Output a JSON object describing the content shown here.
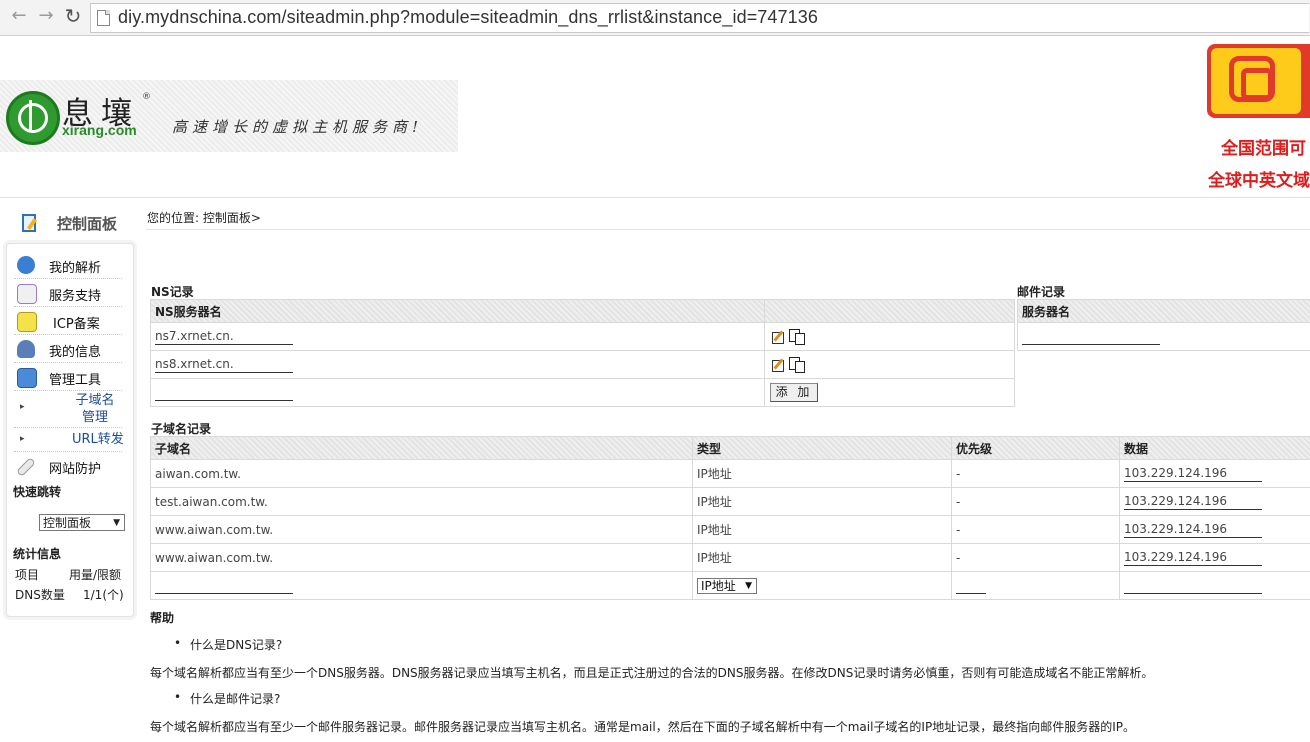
{
  "browser": {
    "url": "diy.mydnschina.com/siteadmin.php?module=siteadmin_dns_rrlist&instance_id=747136"
  },
  "header": {
    "logo_cn": "息壤",
    "logo_reg": "®",
    "logo_en": "xirang.com",
    "slogan": "高速增长的虚拟主机服务商!",
    "ad_line1": "全国范围可",
    "ad_line2": "全球中英文域"
  },
  "sidebar": {
    "title": "控制面板",
    "menu": [
      {
        "label": "我的解析",
        "icon": "globe-icon"
      },
      {
        "label": "服务支持",
        "icon": "person-icon"
      },
      {
        "label": "ICP备案",
        "icon": "certificate-icon"
      },
      {
        "label": "我的信息",
        "icon": "user-icon"
      },
      {
        "label": "管理工具",
        "icon": "tools-icon"
      }
    ],
    "submenu": [
      {
        "label": "子域名管理"
      },
      {
        "label": "URL转发"
      }
    ],
    "protect": {
      "label": "网站防护",
      "icon": "shield-icon"
    },
    "quick_title": "快速跳转",
    "quick_select": "控制面板",
    "stats_title": "统计信息",
    "stats_header": {
      "item": "项目",
      "usage": "用量/限额"
    },
    "stats_row": {
      "item": "DNS数量",
      "usage": "1/1(个)"
    }
  },
  "breadcrumb": "您的位置: 控制面板>",
  "ns": {
    "title": "NS记录",
    "header": "NS服务器名",
    "rows": [
      "ns7.xrnet.cn.",
      "ns8.xrnet.cn."
    ],
    "add_label": "添 加"
  },
  "mail": {
    "title": "邮件记录",
    "header": "服务器名"
  },
  "subdomain": {
    "title": "子域名记录",
    "headers": [
      "子域名",
      "类型",
      "优先级",
      "数据"
    ],
    "rows": [
      {
        "name": "aiwan.com.tw.",
        "type": "IP地址",
        "priority": "-",
        "data": "103.229.124.196"
      },
      {
        "name": "test.aiwan.com.tw.",
        "type": "IP地址",
        "priority": "-",
        "data": "103.229.124.196"
      },
      {
        "name": "www.aiwan.com.tw.",
        "type": "IP地址",
        "priority": "-",
        "data": "103.229.124.196"
      },
      {
        "name": "www.aiwan.com.tw.",
        "type": "IP地址",
        "priority": "-",
        "data": "103.229.124.196"
      }
    ],
    "new_type": "IP地址"
  },
  "help": {
    "title": "帮助",
    "items": [
      {
        "q": "什么是DNS记录?",
        "a": "每个域名解析都应当有至少一个DNS服务器。DNS服务器记录应当填写主机名，而且是正式注册过的合法的DNS服务器。在修改DNS记录时请务必慎重，否则有可能造成域名不能正常解析。"
      },
      {
        "q": "什么是邮件记录?",
        "a": "每个域名解析都应当有至少一个邮件服务器记录。邮件服务器记录应当填写主机名。通常是mail，然后在下面的子域名解析中有一个mail子域名的IP地址记录，最终指向邮件服务器的IP。"
      }
    ]
  },
  "colors": {
    "brand_green": "#2f9a2f",
    "ad_red": "#e01b1b",
    "link_blue": "#1a4e9a"
  }
}
